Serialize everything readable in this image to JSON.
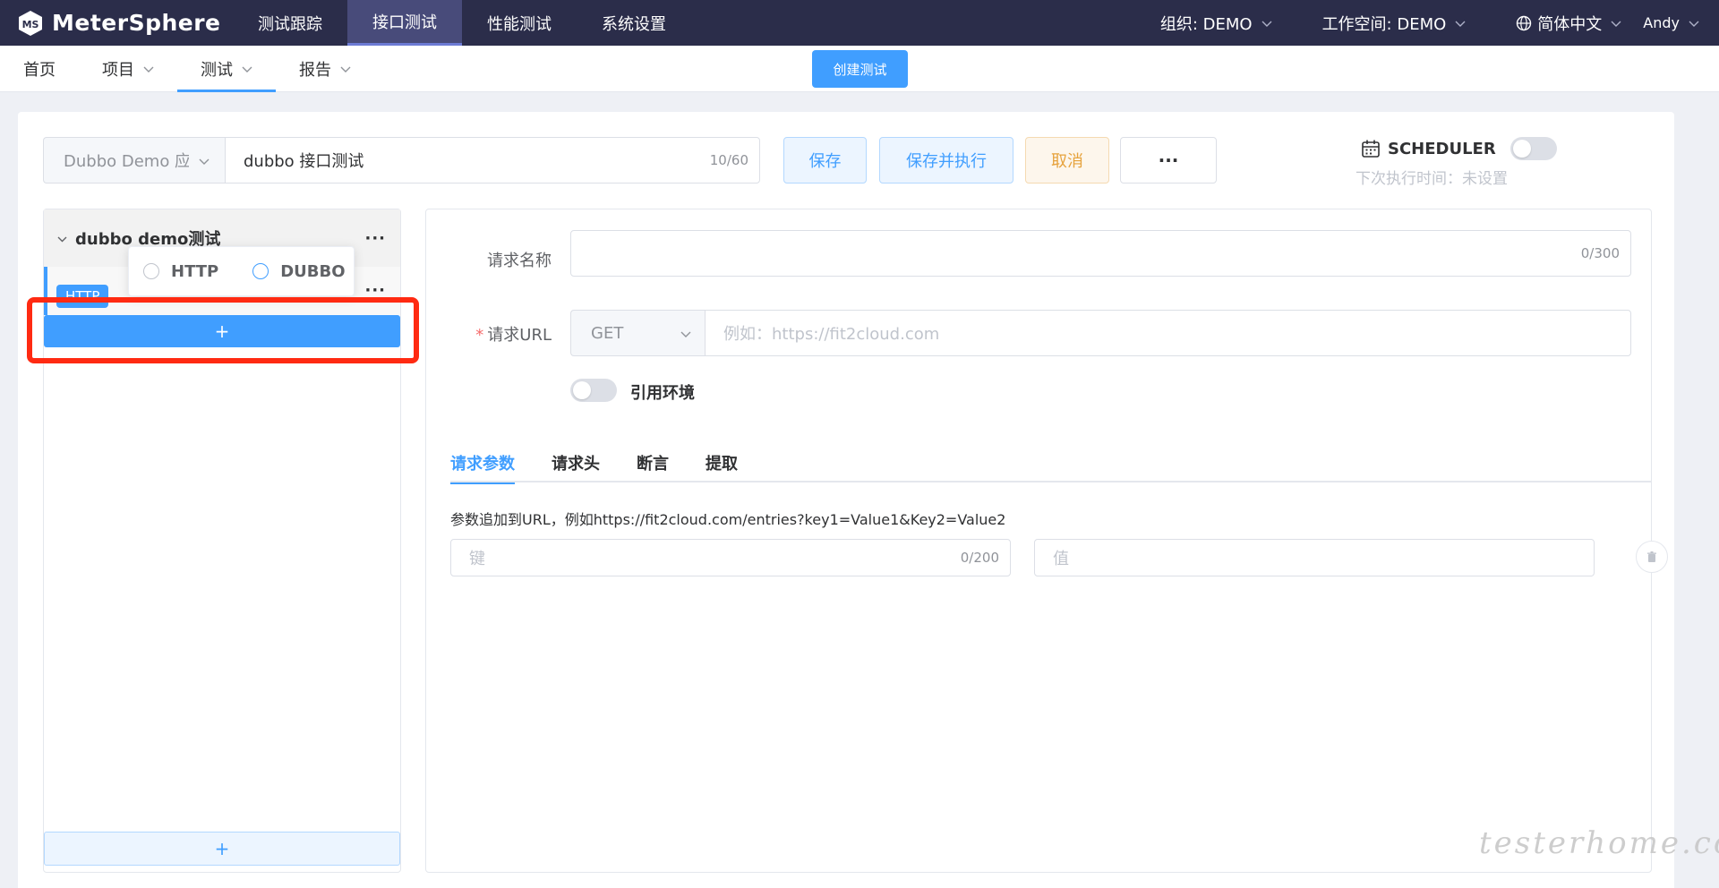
{
  "app": {
    "brand": "MeterSphere",
    "top_nav": [
      {
        "label": "测试跟踪",
        "active": false
      },
      {
        "label": "接口测试",
        "active": true
      },
      {
        "label": "性能测试",
        "active": false
      },
      {
        "label": "系统设置",
        "active": false
      }
    ],
    "org_label": "组织: DEMO",
    "workspace_label": "工作空间: DEMO",
    "language_label": "简体中文",
    "user_label": "Andy"
  },
  "sub_nav": {
    "items": [
      {
        "label": "首页",
        "dropdown": false,
        "active": false
      },
      {
        "label": "项目",
        "dropdown": true,
        "active": false
      },
      {
        "label": "测试",
        "dropdown": true,
        "active": true
      },
      {
        "label": "报告",
        "dropdown": true,
        "active": false
      }
    ],
    "create_button": "创建测试"
  },
  "toolbar": {
    "project_value": "Dubbo Demo 应用",
    "test_name_value": "dubbo 接口测试",
    "test_name_count": "10/60",
    "save_label": "保存",
    "save_run_label": "保存并执行",
    "cancel_label": "取消",
    "more_label": "···",
    "scheduler_label": "SCHEDULER",
    "scheduler_enabled": false,
    "next_run_label": "下次执行时间：未设置"
  },
  "left_panel": {
    "scenario_title": "dubbo demo测试",
    "more_label": "···",
    "request_tag": "HTTP",
    "request_more_label": "···",
    "popover_options": [
      "HTTP",
      "DUBBO"
    ],
    "add_label": "+",
    "add_bottom_label": "+"
  },
  "request_form": {
    "name_label": "请求名称",
    "name_value": "",
    "name_count": "0/300",
    "url_required_mark": "*",
    "url_label": "请求URL",
    "method_value": "GET",
    "url_placeholder": "例如：https://fit2cloud.com",
    "env_toggle_label": "引用环境",
    "env_enabled": false,
    "tabs": [
      {
        "label": "请求参数",
        "active": true
      },
      {
        "label": "请求头",
        "active": false
      },
      {
        "label": "断言",
        "active": false
      },
      {
        "label": "提取",
        "active": false
      }
    ],
    "params_hint": "参数追加到URL，例如https://fit2cloud.com/entries?key1=Value1&Key2=Value2",
    "key_placeholder": "键",
    "key_count": "0/200",
    "value_placeholder": "值"
  },
  "watermark": "testerhome.com",
  "colors": {
    "topbar_bg": "#2b2d4a",
    "primary": "#409eff",
    "warning": "#e6a23c",
    "highlight": "#ff2a12"
  }
}
